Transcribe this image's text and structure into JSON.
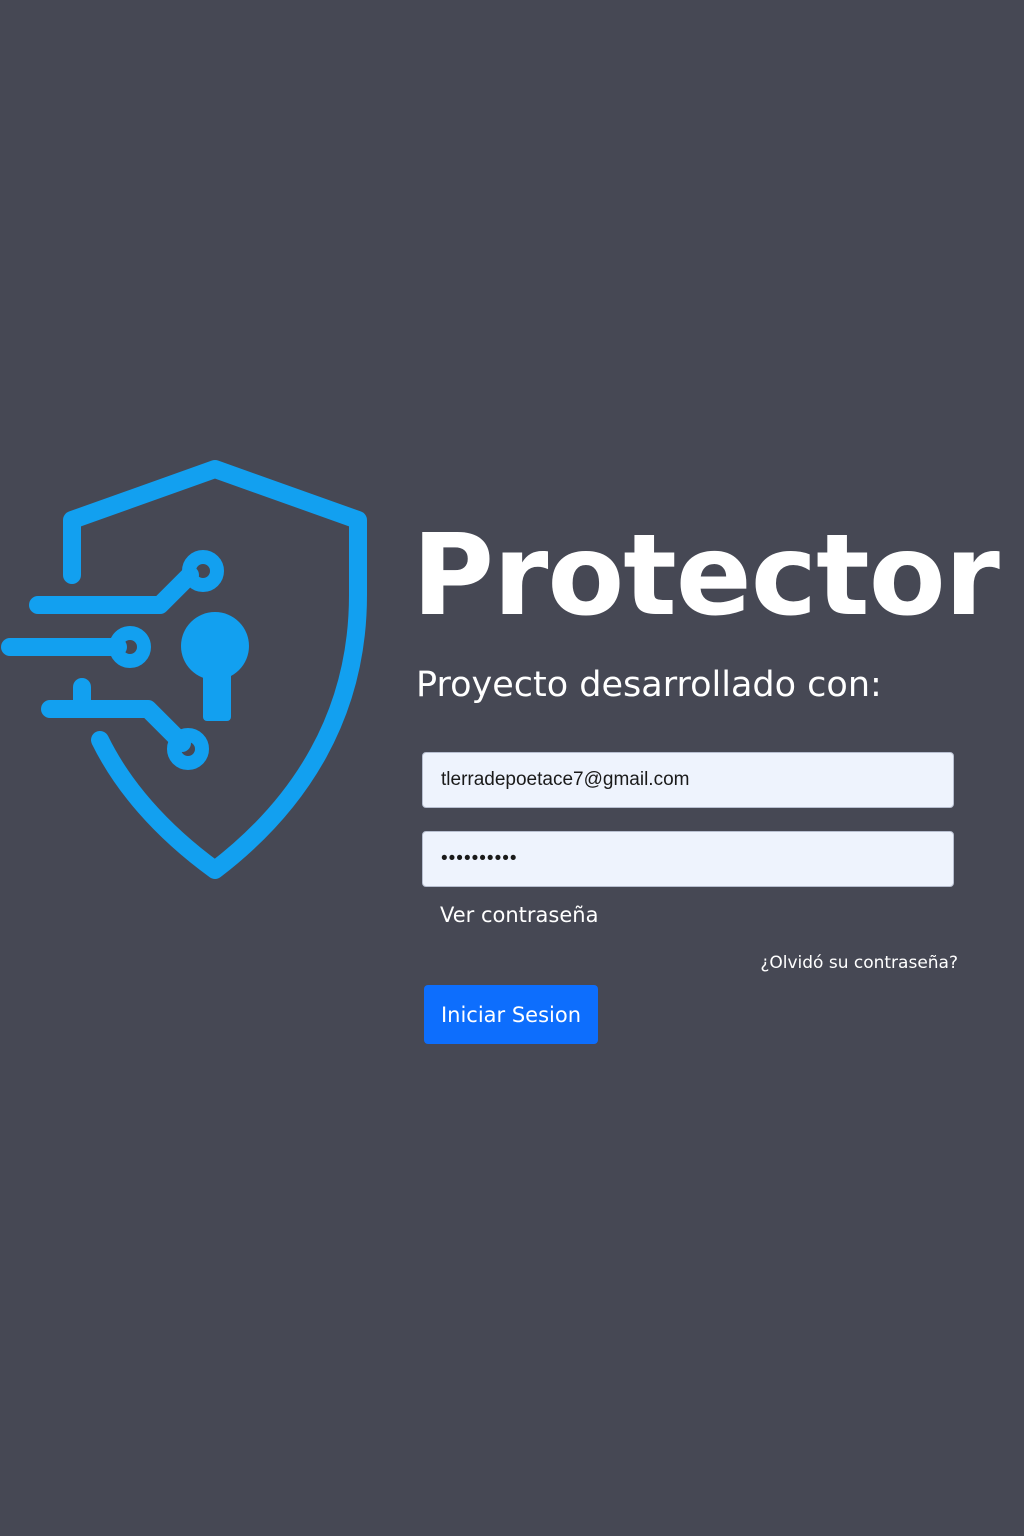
{
  "brand": {
    "title": "Protector",
    "subtitle": "Proyecto desarrollado con:",
    "logo_icon": "shield-keyhole-circuit-icon",
    "accent_color": "#12a0f0"
  },
  "form": {
    "email_value": "tlerradepoetace7@gmail.com",
    "password_value": "••••••••••",
    "show_password_label": "Ver contraseña",
    "forgot_password_label": "¿Olvidó su contraseña?",
    "submit_label": "Iniciar Sesion"
  },
  "colors": {
    "background": "#464854",
    "input_background": "#eef3fd",
    "button": "#0d6efd",
    "text": "#ffffff"
  }
}
